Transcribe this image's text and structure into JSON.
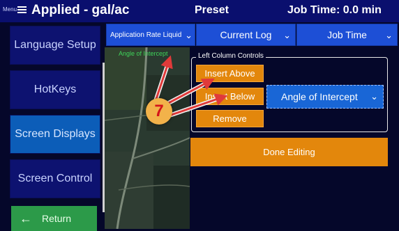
{
  "header": {
    "menu_label": "Menu",
    "title": "Applied - gal/ac",
    "preset": "Preset",
    "job_time": "Job Time: 0.0 min"
  },
  "sidebar": {
    "items": [
      {
        "label": "Language Setup",
        "active": false
      },
      {
        "label": "HotKeys",
        "active": false
      },
      {
        "label": "Screen Displays",
        "active": true
      },
      {
        "label": "Screen Control",
        "active": false
      }
    ],
    "return_label": "Return"
  },
  "dropdowns": [
    {
      "label": "Application Rate Liquid"
    },
    {
      "label": "Current Log"
    },
    {
      "label": "Job Time"
    }
  ],
  "map": {
    "label": "Angle of Intercept"
  },
  "panel": {
    "legend": "Left Column Controls",
    "insert_above": "Insert Above",
    "insert_below": "Insert Below",
    "remove": "Remove",
    "selected": "Angle of Intercept",
    "done": "Done Editing"
  },
  "callout": {
    "number": "7"
  },
  "colors": {
    "background": "#05072a",
    "topbar": "#0a0f6e",
    "dropdown": "#1d4fd6",
    "orange_button": "#e3870c",
    "active_sidebar": "#0c5db8",
    "return_button": "#2c9a49",
    "annotation_arrow": "#e03a3a",
    "callout_badge": "#f2b24a"
  }
}
